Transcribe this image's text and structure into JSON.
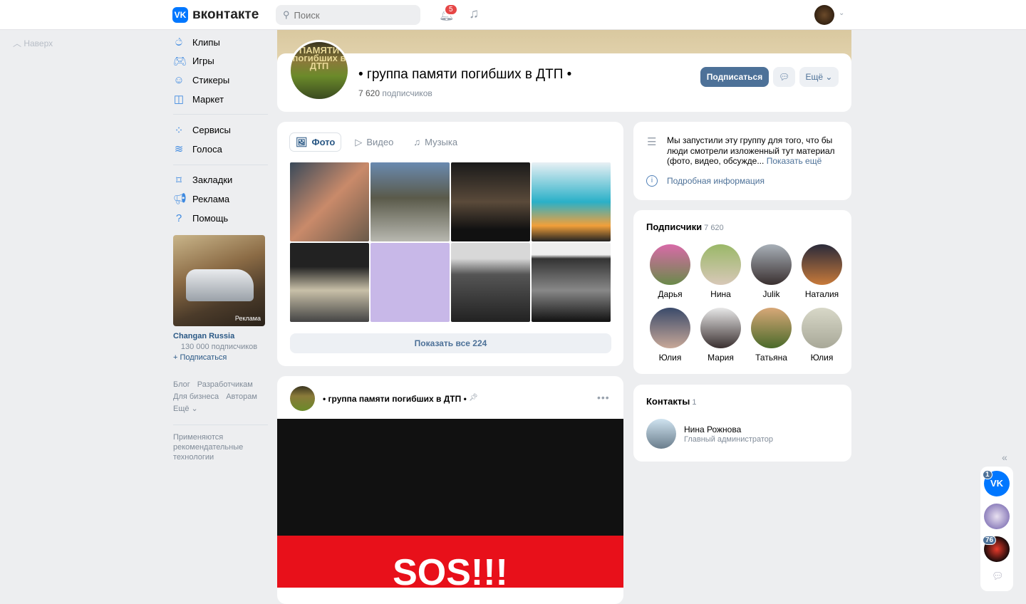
{
  "header": {
    "logo": "вконтакте",
    "search_placeholder": "Поиск",
    "notifications_count": "5"
  },
  "scroll_top": "Наверх",
  "sidebar": {
    "items": [
      {
        "label": "Клипы",
        "icon": "clips-icon"
      },
      {
        "label": "Игры",
        "icon": "gamepad-icon"
      },
      {
        "label": "Стикеры",
        "icon": "sticker-icon"
      },
      {
        "label": "Маркет",
        "icon": "bag-icon"
      },
      {
        "label": "Сервисы",
        "icon": "grid-icon"
      },
      {
        "label": "Голоса",
        "icon": "coins-icon"
      },
      {
        "label": "Закладки",
        "icon": "bookmark-icon"
      },
      {
        "label": "Реклама",
        "icon": "megaphone-icon"
      },
      {
        "label": "Помощь",
        "icon": "help-icon"
      }
    ]
  },
  "ad": {
    "label": "Реклама",
    "name": "Changan Russia",
    "subscribers": "130 000 подписчиков",
    "follow": "+ Подписаться"
  },
  "footer": {
    "links": [
      "Блог",
      "Разработчикам",
      "Для бизнеса",
      "Авторам"
    ],
    "more": "Ещё ⌄",
    "note": "Применяются рекомендательные технологии"
  },
  "group": {
    "title": "• группа памяти погибших в ДТП •",
    "avatar_text": "ПАМЯТИ погибших в ДТП",
    "subs_count": "7 620",
    "subs_label": "подписчиков",
    "subscribe": "Подписаться",
    "more": "Ещё"
  },
  "media": {
    "tabs": [
      "Фото",
      "Видео",
      "Музыка"
    ],
    "show_all": "Показать все 224"
  },
  "about": {
    "text": "Мы запустили эту группу для того, что бы люди смотрели изложенный тут материал (фото, видео, обсужде...",
    "show_more": "Показать ещё",
    "details": "Подробная информация"
  },
  "members": {
    "title": "Подписчики",
    "count": "7 620",
    "list": [
      "Дарья",
      "Нина",
      "Julik",
      "Наталия",
      "Юлия",
      "Мария",
      "Татьяна",
      "Юлия"
    ]
  },
  "contacts": {
    "title": "Контакты",
    "count": "1",
    "name": "Нина Рожнова",
    "role": "Главный администратор"
  },
  "post": {
    "author": "• группа памяти погибших в ДТП •",
    "image_text": "SOS!!!"
  },
  "right_panel": {
    "badges": [
      "1",
      "76"
    ]
  }
}
